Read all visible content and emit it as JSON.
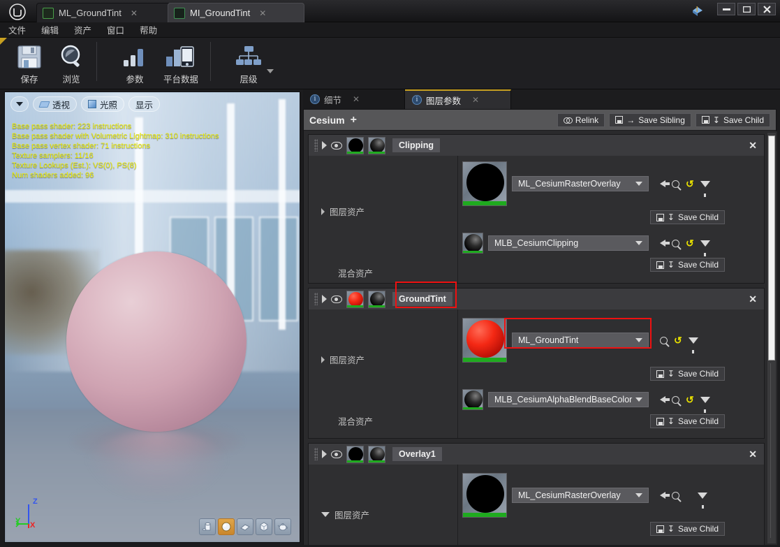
{
  "window": {
    "minimize_label": "—",
    "maximize_label": "❐",
    "close_label": "✕",
    "app_logo": "unreal-engine-logo"
  },
  "tabs": [
    {
      "label": "ML_GroundTint",
      "close": "✕",
      "active": false
    },
    {
      "label": "MI_GroundTint",
      "close": "✕",
      "active": true
    }
  ],
  "menubar": [
    {
      "label": "文件"
    },
    {
      "label": "编辑"
    },
    {
      "label": "资产"
    },
    {
      "label": "窗口"
    },
    {
      "label": "帮助"
    }
  ],
  "toolbar": [
    {
      "label": "保存",
      "icon": "save-disk-icon"
    },
    {
      "label": "浏览",
      "icon": "browse-magnifier-icon"
    },
    {
      "label": "参数",
      "icon": "parameters-bars-icon"
    },
    {
      "label": "平台数据",
      "icon": "platform-stats-icon"
    },
    {
      "label": "层级",
      "icon": "hierarchy-tree-icon"
    }
  ],
  "viewport": {
    "buttons": [
      {
        "label": "",
        "icon": "chevron-down-icon"
      },
      {
        "label": "透视",
        "icon": "perspective-icon"
      },
      {
        "label": "光照",
        "icon": "lit-cube-icon"
      },
      {
        "label": "显示",
        "icon": "show-icon"
      }
    ],
    "stats": [
      "Base pass shader: 223 instructions",
      "Base pass shader with Volumetric Lightmap: 310 instructions",
      "Base pass vertex shader: 71 instructions",
      "Texture samplers: 11/16",
      "Texture Lookups (Est.): VS(0), PS(8)",
      "Num shaders added: 96"
    ],
    "gizmo": {
      "x": "X",
      "y": "Y",
      "z": "Z",
      "x_color": "#ee2222",
      "y_color": "#22cc22",
      "z_color": "#3355ee"
    },
    "shapes": [
      {
        "name": "cylinder-preview-button",
        "selected": false
      },
      {
        "name": "sphere-preview-button",
        "selected": true
      },
      {
        "name": "plane-preview-button",
        "selected": false
      },
      {
        "name": "cube-preview-button",
        "selected": false
      },
      {
        "name": "teapot-preview-button",
        "selected": false
      }
    ],
    "preview_color": "#d9b0bd"
  },
  "panel": {
    "tabs": [
      {
        "label": "细节",
        "active": false,
        "close": "✕"
      },
      {
        "label": "图层参数",
        "active": true,
        "close": "✕"
      }
    ],
    "header": {
      "title": "Cesium",
      "add_label": "+",
      "buttons": [
        {
          "label": "Relink",
          "icon": "link-icon"
        },
        {
          "label": "Save Sibling",
          "icon": "save-sibling-icon",
          "arrow": "→"
        },
        {
          "label": "Save Child",
          "icon": "save-child-icon",
          "arrow": "↧"
        }
      ]
    },
    "labels": {
      "layer_asset": "图层资产",
      "blend_asset": "混合资产",
      "save_child": "Save Child"
    },
    "layers": [
      {
        "name": "Clipping",
        "close": "✕",
        "expanded": true,
        "layer_thumb_color": "#000000",
        "blend_thumb_color": "#2d2d2d",
        "layer_asset": {
          "value": "ML_CesiumRasterOverlay",
          "thumb": "black",
          "icons": [
            "use-selected-icon",
            "browse-icon",
            "reset-icon",
            "filter-icon"
          ],
          "highlighted": false
        },
        "blend_asset": {
          "value": "MLB_CesiumClipping",
          "thumb": "blackshine",
          "icons": [
            "use-selected-icon",
            "browse-icon",
            "reset-icon",
            "filter-icon"
          ]
        }
      },
      {
        "name": "GroundTint",
        "close": "✕",
        "expanded": true,
        "name_highlighted": true,
        "layer_thumb_color": "#f42814",
        "blend_thumb_color": "#2d2d2d",
        "layer_asset": {
          "value": "ML_GroundTint",
          "thumb": "red",
          "icons": [
            "use-selected-icon",
            "browse-icon",
            "reset-icon",
            "filter-icon"
          ],
          "highlighted": true
        },
        "blend_asset": {
          "value": "MLB_CesiumAlphaBlendBaseColor",
          "thumb": "blackshine",
          "icons": [
            "use-selected-icon",
            "browse-icon",
            "reset-icon",
            "filter-icon"
          ]
        }
      },
      {
        "name": "Overlay1",
        "close": "✕",
        "expanded": true,
        "layer_thumb_color": "#000000",
        "blend_thumb_color": "#2d2d2d",
        "layer_asset": {
          "value": "ML_CesiumRasterOverlay",
          "thumb": "black",
          "icons": [
            "use-selected-icon",
            "browse-icon",
            "filter-icon"
          ],
          "highlighted": false
        }
      }
    ],
    "highlight_color": "#ee1111"
  }
}
